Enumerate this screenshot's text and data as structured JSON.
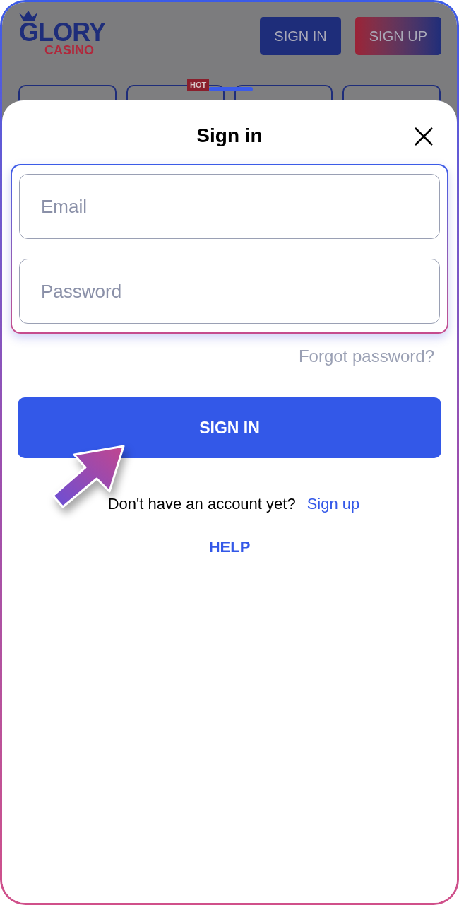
{
  "header": {
    "logo": {
      "title": "GLORY",
      "subtitle": "CASINO"
    },
    "buttons": [
      {
        "label": "SIGN IN",
        "kind": "primary"
      },
      {
        "label": "SIGN UP",
        "kind": "gradient"
      }
    ]
  },
  "categories": [
    {
      "kind": "plain"
    },
    {
      "kind": "hot",
      "badge": "HOT"
    },
    {
      "kind": "plain"
    },
    {
      "kind": "plain"
    }
  ],
  "dialog": {
    "title": "Sign in",
    "fields": [
      {
        "placeholder": "Email"
      },
      {
        "placeholder": "Password"
      }
    ],
    "forgot_link": "Forgot password?",
    "submit": "SIGN IN",
    "signup_prompt": "Don't have an account yet?",
    "signup_link": "Sign up",
    "help_link": "HELP"
  }
}
